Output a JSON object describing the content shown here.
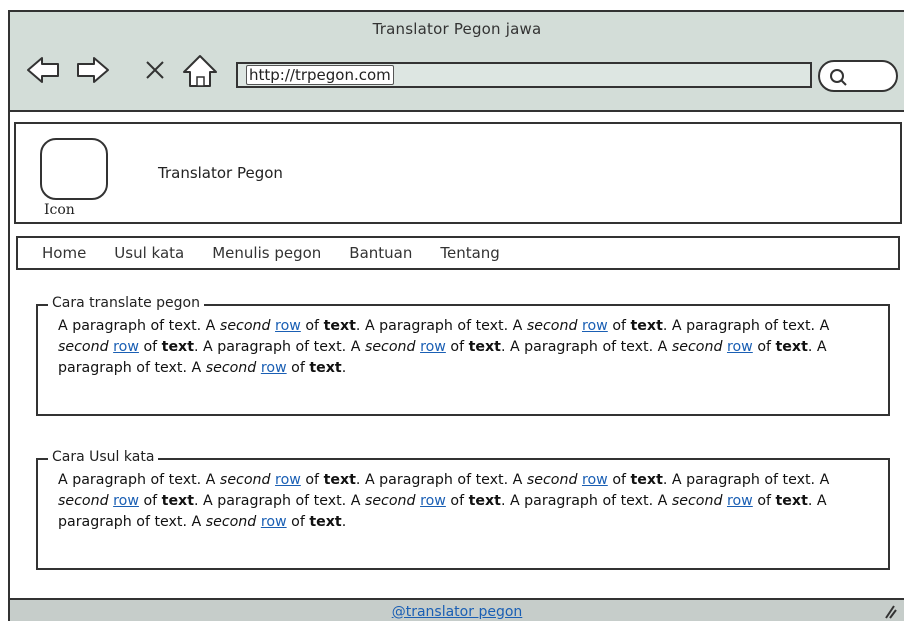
{
  "browser": {
    "window_title": "Translator Pegon jawa",
    "url": "http://trpegon.com",
    "icons": [
      "back-arrow-icon",
      "forward-arrow-icon",
      "close-icon",
      "home-icon",
      "search-icon"
    ]
  },
  "header": {
    "logo_label": "Icon",
    "site_name": "Translator Pegon"
  },
  "nav": {
    "items": [
      "Home",
      "Usul kata",
      "Menulis pegon",
      "Bantuan",
      "Tentang"
    ]
  },
  "sections": [
    {
      "legend": "Cara translate pegon",
      "paragraph": {
        "text_a": "A paragraph of text. A",
        "italic": "second",
        "link": "row",
        "text_b": "of",
        "bold": "text",
        "text_c": ". A paragraph of text. A"
      }
    },
    {
      "legend": "Cara Usul kata",
      "paragraph": {
        "text_a": "A paragraph of text. A",
        "italic": "second",
        "link": "row",
        "text_b": "of",
        "bold": "text",
        "text_c": ". A paragraph of text. A"
      }
    }
  ],
  "footer": {
    "link": "@translator pegon"
  },
  "colors": {
    "titlebar": "#d3ddd8",
    "link": "#1a5fb4",
    "statusbar": "#c6cdca"
  }
}
